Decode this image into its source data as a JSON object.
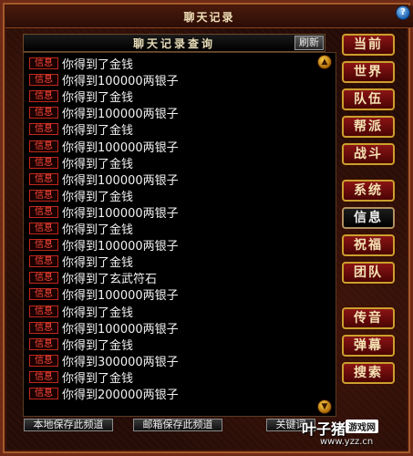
{
  "window": {
    "title": "聊天记录",
    "help_label": "?"
  },
  "search": {
    "label": "聊天记录查询",
    "refresh_label": "刷新"
  },
  "messages": [
    {
      "tag": "信息",
      "text": "你得到了金钱"
    },
    {
      "tag": "信息",
      "text": "你得到100000两银子"
    },
    {
      "tag": "信息",
      "text": "你得到了金钱"
    },
    {
      "tag": "信息",
      "text": "你得到100000两银子"
    },
    {
      "tag": "信息",
      "text": "你得到了金钱"
    },
    {
      "tag": "信息",
      "text": "你得到100000两银子"
    },
    {
      "tag": "信息",
      "text": "你得到了金钱"
    },
    {
      "tag": "信息",
      "text": "你得到100000两银子"
    },
    {
      "tag": "信息",
      "text": "你得到了金钱"
    },
    {
      "tag": "信息",
      "text": "你得到100000两银子"
    },
    {
      "tag": "信息",
      "text": "你得到了金钱"
    },
    {
      "tag": "信息",
      "text": "你得到100000两银子"
    },
    {
      "tag": "信息",
      "text": "你得到了金钱"
    },
    {
      "tag": "信息",
      "text": "你得到了玄武符石"
    },
    {
      "tag": "信息",
      "text": "你得到100000两银子"
    },
    {
      "tag": "信息",
      "text": "你得到了金钱"
    },
    {
      "tag": "信息",
      "text": "你得到100000两银子"
    },
    {
      "tag": "信息",
      "text": "你得到了金钱"
    },
    {
      "tag": "信息",
      "text": "你得到300000两银子"
    },
    {
      "tag": "信息",
      "text": "你得到了金钱"
    },
    {
      "tag": "信息",
      "text": "你得到200000两银子"
    }
  ],
  "tabs": [
    {
      "label": "当前",
      "active": false
    },
    {
      "label": "世界",
      "active": false
    },
    {
      "label": "队伍",
      "active": false
    },
    {
      "label": "帮派",
      "active": false
    },
    {
      "label": "战斗",
      "active": false
    },
    {
      "label": "系统",
      "active": false
    },
    {
      "label": "信息",
      "active": true
    },
    {
      "label": "祝福",
      "active": false
    },
    {
      "label": "团队",
      "active": false
    },
    {
      "label": "传音",
      "active": false
    },
    {
      "label": "弹幕",
      "active": false
    },
    {
      "label": "搜索",
      "active": false
    }
  ],
  "footer": {
    "save_local": "本地保存此频道",
    "save_mail": "邮箱保存此频道",
    "keywords": "关键词"
  },
  "watermark": {
    "main": "叶子猪",
    "badge": "游戏网",
    "url": "www.yzz.cn"
  },
  "colors": {
    "tab_bg": "#8a1414",
    "tab_border": "#c9a02e",
    "tag_red": "#ff4a3a"
  }
}
